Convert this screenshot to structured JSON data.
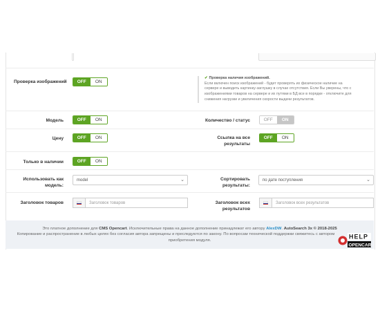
{
  "rows": {
    "check_images": {
      "label": "Проверка изображений",
      "off": "OFF",
      "on": "ON"
    },
    "model": {
      "label": "Модель",
      "off": "OFF",
      "on": "ON"
    },
    "quantity_status": {
      "label": "Количество / статус",
      "off": "OFF",
      "on": "ON"
    },
    "price": {
      "label": "Цену",
      "off": "OFF",
      "on": "ON"
    },
    "links_all_results": {
      "label_line1": "Ссылка на все",
      "label_line2": "результаты",
      "off": "OFF",
      "on": "ON"
    },
    "in_stock_only": {
      "label": "Только в наличии",
      "off": "OFF",
      "on": "ON"
    },
    "use_as_models": {
      "label_line1": "Использовать как",
      "label_line2": "модель:",
      "value": "model"
    },
    "sort_results": {
      "label_line1": "Сортировать",
      "label_line2": "результаты:",
      "value": "по дате поступления"
    },
    "products_heading": {
      "label": "Заголовок товаров",
      "placeholder": "Заголовок товаров"
    },
    "all_results_heading": {
      "label_line1": "Заголовок всех",
      "label_line2": "результатов",
      "placeholder": "Заголовок всех результатов"
    }
  },
  "note": {
    "title": "Проверка наличия изображений.",
    "lines": [
      "Если включен поиск изображений - будет проверять их физическое наличие на",
      "сервере и выводить картинку-заглушку в случае отсутствия. Если Вы уверены, что с",
      "изображениями товаров на сервере и их путями в БД все в порядке - отключите для",
      "снижения нагрузки и увеличения скорости выдачи результатов."
    ]
  },
  "footer": {
    "l1_a": "Это платное дополнение для ",
    "l1_cms": "CMS Opencart",
    "l1_b": ". Исключительные права на данное дополнение принадлежат его автору ",
    "l1_author": "AlexDW",
    "l1_c": ". ",
    "l1_product": "AutoSearch 3x",
    "l1_years": " © 2018-2025",
    "l2": "Копирование и распространение в любых целях без согласия автора запрещены и преследуются по закону. По вопросам технической поддержки свяжитесь с автором",
    "l3": "приобретения модуля."
  },
  "logo": {
    "top": "HELP",
    "bottom": "OPENCART"
  },
  "colors": {
    "accent_green": "#5da423",
    "footer_bg": "#eef1f5",
    "author_link": "#2a8ec6"
  }
}
